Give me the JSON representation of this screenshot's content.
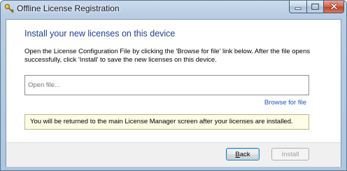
{
  "window": {
    "title": "Offline License Registration",
    "icon": "key-icon",
    "controls": {
      "minimize": "minimize-icon",
      "maximize": "maximize-icon",
      "close": "close-icon"
    }
  },
  "content": {
    "heading": "Install your new licenses on this device",
    "instructions": "Open the License Configuration File by clicking the 'Browse for file' link below. After the file opens successfully, click 'Install' to save the new licenses on this device.",
    "file_input": {
      "value": "",
      "placeholder": "Open file..."
    },
    "browse_link": "Browse for file",
    "info_message": "You will be returned to the main License Manager screen after your licenses are installed."
  },
  "footer": {
    "back_label_first": "B",
    "back_label_rest": "ack",
    "install_label": "Install",
    "install_enabled": false
  },
  "colors": {
    "heading": "#1e3f8f",
    "link": "#1f55b4",
    "info_background": "#fdfce4",
    "title_bar": "#b8cde3",
    "close_button": "#c24126"
  }
}
